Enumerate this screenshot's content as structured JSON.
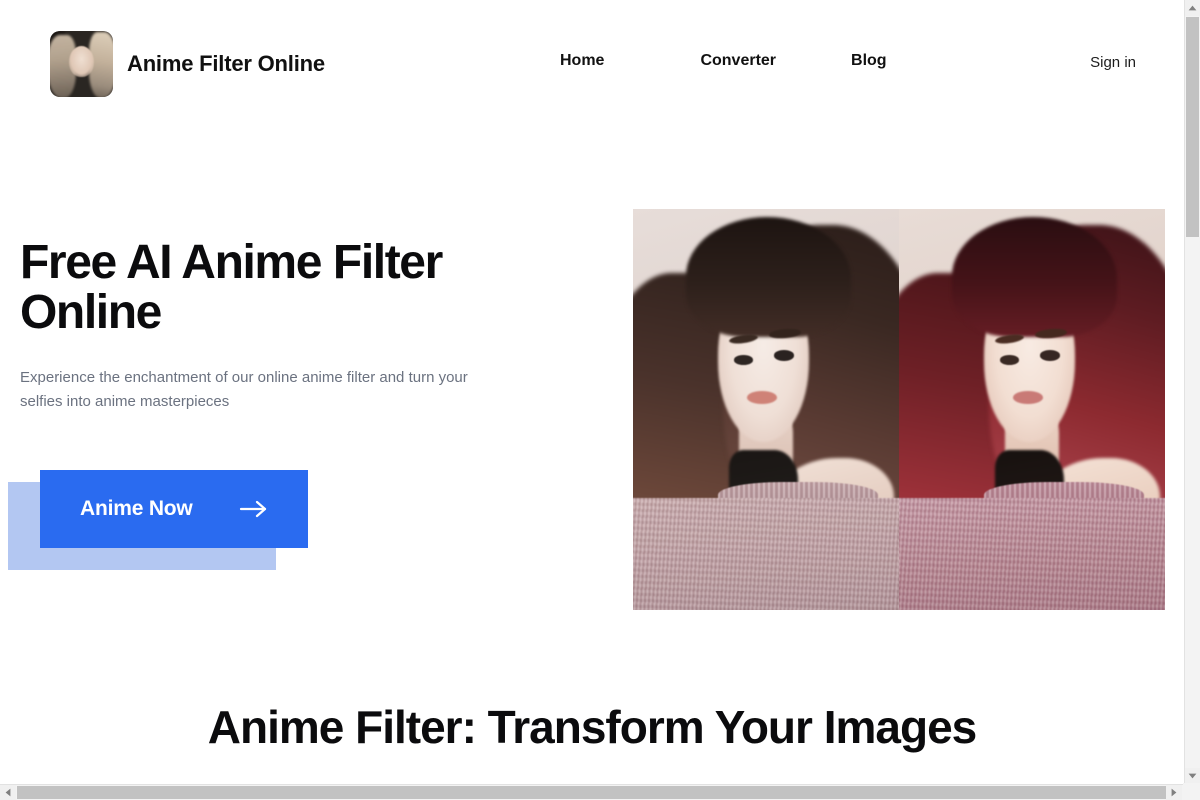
{
  "header": {
    "logo_icon": "brand-avatar-photo",
    "brand_title": "Anime Filter Online",
    "nav": [
      {
        "label": "Home"
      },
      {
        "label": "Converter"
      },
      {
        "label": "Blog"
      }
    ],
    "signin_label": "Sign in"
  },
  "hero": {
    "title": "Free AI Anime Filter Online",
    "subtitle": "Experience the enchantment of our online anime filter and turn your selfies into anime masterpieces",
    "cta": {
      "label": "Anime Now",
      "icon": "arrow-right-icon",
      "background_color": "#2a6bf0",
      "shadow_color": "#b3c7f2",
      "text_color": "#ffffff"
    },
    "images": {
      "before": {
        "alt": "Portrait photo of a woman with dark brown wavy hair wearing a mauve off-shoulder knit sweater"
      },
      "after": {
        "alt": "Anime-filtered version of the same portrait with red auburn hair and warmer pink tones"
      }
    }
  },
  "section": {
    "heading": "Anime Filter: Transform Your Images"
  },
  "scrollbars": {
    "vertical": {
      "up_icon": "caret-up-icon",
      "down_icon": "caret-down-icon"
    },
    "horizontal": {
      "left_icon": "caret-left-icon",
      "right_icon": "caret-right-icon"
    }
  },
  "colors": {
    "page_background": "#ffffff",
    "text_primary": "#0b0b0d",
    "text_muted": "#6b7280",
    "accent_blue": "#2a6bf0",
    "accent_blue_light": "#b3c7f2",
    "scrollbar_track": "#f3f3f3",
    "scrollbar_thumb": "#c2c2c2"
  }
}
